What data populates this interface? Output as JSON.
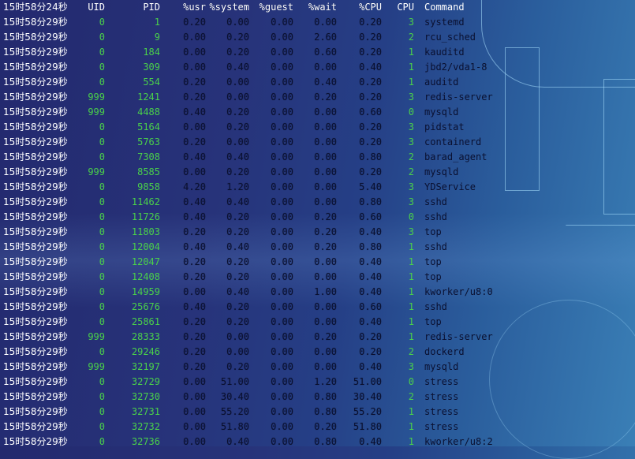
{
  "header": {
    "time": "15时58分24秒",
    "uid": "UID",
    "pid": "PID",
    "usr": "%usr",
    "system": "%system",
    "guest": "%guest",
    "wait": "%wait",
    "cpu_pct": "%CPU",
    "cpu": "CPU",
    "command": "Command"
  },
  "rows": [
    {
      "time": "15时58分29秒",
      "uid": "0",
      "pid": "1",
      "usr": "0.20",
      "system": "0.00",
      "guest": "0.00",
      "wait": "0.00",
      "cpu_pct": "0.20",
      "cpu": "3",
      "command": "systemd"
    },
    {
      "time": "15时58分29秒",
      "uid": "0",
      "pid": "9",
      "usr": "0.00",
      "system": "0.20",
      "guest": "0.00",
      "wait": "2.60",
      "cpu_pct": "0.20",
      "cpu": "2",
      "command": "rcu_sched"
    },
    {
      "time": "15时58分29秒",
      "uid": "0",
      "pid": "184",
      "usr": "0.00",
      "system": "0.20",
      "guest": "0.00",
      "wait": "0.60",
      "cpu_pct": "0.20",
      "cpu": "1",
      "command": "kauditd"
    },
    {
      "time": "15时58分29秒",
      "uid": "0",
      "pid": "309",
      "usr": "0.00",
      "system": "0.40",
      "guest": "0.00",
      "wait": "0.00",
      "cpu_pct": "0.40",
      "cpu": "1",
      "command": "jbd2/vda1-8"
    },
    {
      "time": "15时58分29秒",
      "uid": "0",
      "pid": "554",
      "usr": "0.20",
      "system": "0.00",
      "guest": "0.00",
      "wait": "0.40",
      "cpu_pct": "0.20",
      "cpu": "1",
      "command": "auditd"
    },
    {
      "time": "15时58分29秒",
      "uid": "999",
      "pid": "1241",
      "usr": "0.20",
      "system": "0.00",
      "guest": "0.00",
      "wait": "0.20",
      "cpu_pct": "0.20",
      "cpu": "3",
      "command": "redis-server"
    },
    {
      "time": "15时58分29秒",
      "uid": "999",
      "pid": "4488",
      "usr": "0.40",
      "system": "0.20",
      "guest": "0.00",
      "wait": "0.00",
      "cpu_pct": "0.60",
      "cpu": "0",
      "command": "mysqld"
    },
    {
      "time": "15时58分29秒",
      "uid": "0",
      "pid": "5164",
      "usr": "0.00",
      "system": "0.20",
      "guest": "0.00",
      "wait": "0.00",
      "cpu_pct": "0.20",
      "cpu": "3",
      "command": "pidstat"
    },
    {
      "time": "15时58分29秒",
      "uid": "0",
      "pid": "5763",
      "usr": "0.20",
      "system": "0.00",
      "guest": "0.00",
      "wait": "0.00",
      "cpu_pct": "0.20",
      "cpu": "3",
      "command": "containerd"
    },
    {
      "time": "15时58分29秒",
      "uid": "0",
      "pid": "7308",
      "usr": "0.40",
      "system": "0.40",
      "guest": "0.00",
      "wait": "0.00",
      "cpu_pct": "0.80",
      "cpu": "2",
      "command": "barad_agent"
    },
    {
      "time": "15时58分29秒",
      "uid": "999",
      "pid": "8585",
      "usr": "0.00",
      "system": "0.20",
      "guest": "0.00",
      "wait": "0.00",
      "cpu_pct": "0.20",
      "cpu": "2",
      "command": "mysqld"
    },
    {
      "time": "15时58分29秒",
      "uid": "0",
      "pid": "9858",
      "usr": "4.20",
      "system": "1.20",
      "guest": "0.00",
      "wait": "0.00",
      "cpu_pct": "5.40",
      "cpu": "3",
      "command": "YDService"
    },
    {
      "time": "15时58分29秒",
      "uid": "0",
      "pid": "11462",
      "usr": "0.40",
      "system": "0.40",
      "guest": "0.00",
      "wait": "0.00",
      "cpu_pct": "0.80",
      "cpu": "3",
      "command": "sshd"
    },
    {
      "time": "15时58分29秒",
      "uid": "0",
      "pid": "11726",
      "usr": "0.40",
      "system": "0.20",
      "guest": "0.00",
      "wait": "0.20",
      "cpu_pct": "0.60",
      "cpu": "0",
      "command": "sshd"
    },
    {
      "time": "15时58分29秒",
      "uid": "0",
      "pid": "11803",
      "usr": "0.20",
      "system": "0.20",
      "guest": "0.00",
      "wait": "0.20",
      "cpu_pct": "0.40",
      "cpu": "3",
      "command": "top"
    },
    {
      "time": "15时58分29秒",
      "uid": "0",
      "pid": "12004",
      "usr": "0.40",
      "system": "0.40",
      "guest": "0.00",
      "wait": "0.20",
      "cpu_pct": "0.80",
      "cpu": "1",
      "command": "sshd"
    },
    {
      "time": "15时58分29秒",
      "uid": "0",
      "pid": "12047",
      "usr": "0.20",
      "system": "0.20",
      "guest": "0.00",
      "wait": "0.00",
      "cpu_pct": "0.40",
      "cpu": "1",
      "command": "top"
    },
    {
      "time": "15时58分29秒",
      "uid": "0",
      "pid": "12408",
      "usr": "0.20",
      "system": "0.20",
      "guest": "0.00",
      "wait": "0.00",
      "cpu_pct": "0.40",
      "cpu": "1",
      "command": "top"
    },
    {
      "time": "15时58分29秒",
      "uid": "0",
      "pid": "14959",
      "usr": "0.00",
      "system": "0.40",
      "guest": "0.00",
      "wait": "1.00",
      "cpu_pct": "0.40",
      "cpu": "1",
      "command": "kworker/u8:0"
    },
    {
      "time": "15时58分29秒",
      "uid": "0",
      "pid": "25676",
      "usr": "0.40",
      "system": "0.20",
      "guest": "0.00",
      "wait": "0.00",
      "cpu_pct": "0.60",
      "cpu": "1",
      "command": "sshd"
    },
    {
      "time": "15时58分29秒",
      "uid": "0",
      "pid": "25861",
      "usr": "0.20",
      "system": "0.20",
      "guest": "0.00",
      "wait": "0.00",
      "cpu_pct": "0.40",
      "cpu": "1",
      "command": "top"
    },
    {
      "time": "15时58分29秒",
      "uid": "999",
      "pid": "28333",
      "usr": "0.20",
      "system": "0.00",
      "guest": "0.00",
      "wait": "0.20",
      "cpu_pct": "0.20",
      "cpu": "1",
      "command": "redis-server"
    },
    {
      "time": "15时58分29秒",
      "uid": "0",
      "pid": "29246",
      "usr": "0.20",
      "system": "0.00",
      "guest": "0.00",
      "wait": "0.00",
      "cpu_pct": "0.20",
      "cpu": "2",
      "command": "dockerd"
    },
    {
      "time": "15时58分29秒",
      "uid": "999",
      "pid": "32197",
      "usr": "0.20",
      "system": "0.20",
      "guest": "0.00",
      "wait": "0.00",
      "cpu_pct": "0.40",
      "cpu": "3",
      "command": "mysqld"
    },
    {
      "time": "15时58分29秒",
      "uid": "0",
      "pid": "32729",
      "usr": "0.00",
      "system": "51.00",
      "guest": "0.00",
      "wait": "1.20",
      "cpu_pct": "51.00",
      "cpu": "0",
      "command": "stress"
    },
    {
      "time": "15时58分29秒",
      "uid": "0",
      "pid": "32730",
      "usr": "0.00",
      "system": "30.40",
      "guest": "0.00",
      "wait": "0.80",
      "cpu_pct": "30.40",
      "cpu": "2",
      "command": "stress"
    },
    {
      "time": "15时58分29秒",
      "uid": "0",
      "pid": "32731",
      "usr": "0.00",
      "system": "55.20",
      "guest": "0.00",
      "wait": "0.80",
      "cpu_pct": "55.20",
      "cpu": "1",
      "command": "stress"
    },
    {
      "time": "15时58分29秒",
      "uid": "0",
      "pid": "32732",
      "usr": "0.00",
      "system": "51.80",
      "guest": "0.00",
      "wait": "0.20",
      "cpu_pct": "51.80",
      "cpu": "1",
      "command": "stress"
    },
    {
      "time": "15时58分29秒",
      "uid": "0",
      "pid": "32736",
      "usr": "0.00",
      "system": "0.40",
      "guest": "0.00",
      "wait": "0.80",
      "cpu_pct": "0.40",
      "cpu": "1",
      "command": "kworker/u8:2"
    }
  ]
}
